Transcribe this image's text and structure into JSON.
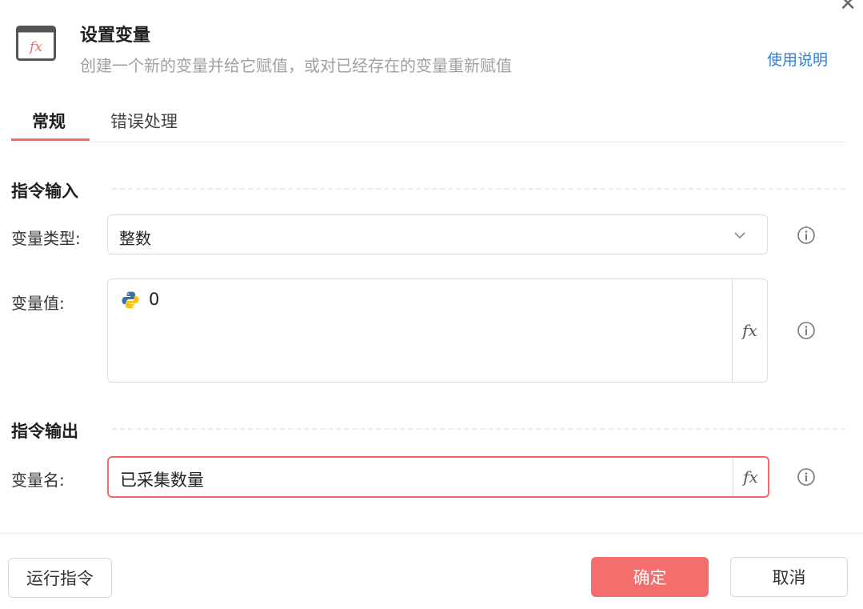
{
  "header": {
    "title": "设置变量",
    "subtitle": "创建一个新的变量并给它赋值，或对已经存在的变量重新赋值",
    "help_link": "使用说明",
    "icon": "fx-function-icon",
    "close_icon": "close-icon"
  },
  "tabs": [
    {
      "label": "常规",
      "active": true
    },
    {
      "label": "错误处理",
      "active": false
    }
  ],
  "input_section": {
    "title": "指令输入",
    "variable_type": {
      "label": "变量类型:",
      "value": "整数"
    },
    "variable_value": {
      "label": "变量值:",
      "value": "0",
      "fx_label": "fx"
    }
  },
  "output_section": {
    "title": "指令输出",
    "variable_name": {
      "label": "变量名:",
      "value": "已采集数量",
      "fx_label": "fx"
    }
  },
  "footer": {
    "run_label": "运行指令",
    "ok_label": "确定",
    "cancel_label": "取消"
  },
  "colors": {
    "accent": "#f46e6e",
    "link": "#2f80d6",
    "border": "#dcdcdc"
  }
}
